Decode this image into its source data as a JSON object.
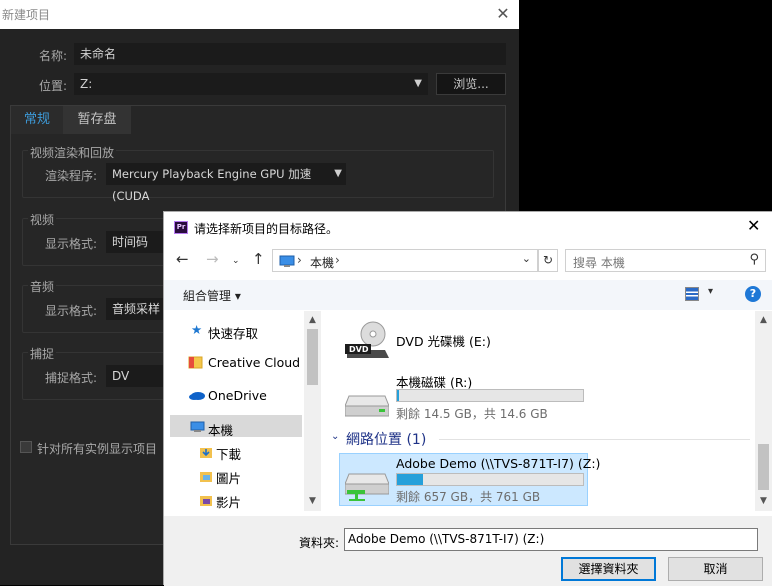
{
  "new_project": {
    "title": "新建项目",
    "close": "✕",
    "name_label": "名称:",
    "name_value": "未命名",
    "location_label": "位置:",
    "location_value": "Z:",
    "browse_label": "浏览...",
    "tabs": [
      {
        "label": "常规",
        "active": true
      },
      {
        "label": "暂存盘",
        "active": false
      }
    ],
    "sections": {
      "render": {
        "title": "视频渲染和回放",
        "renderer_label": "渲染程序:",
        "renderer_value": "Mercury Playback Engine GPU 加速 (CUDA"
      },
      "video": {
        "title": "视频",
        "format_label": "显示格式:",
        "format_value": "时间码"
      },
      "audio": {
        "title": "音频",
        "format_label": "显示格式:",
        "format_value": "音频采样"
      },
      "capture": {
        "title": "捕捉",
        "format_label": "捕捉格式:",
        "format_value": "DV"
      }
    },
    "checkbox_label": "针对所有实例显示项目",
    "accent_color": "#3d9ad8"
  },
  "folder_picker": {
    "title": "请选择新项目的目标路径。",
    "address": {
      "crumb": "本機",
      "separator": "›"
    },
    "search_placeholder": "搜尋 本機",
    "organize_label": "組合管理",
    "help_label": "?",
    "nav_items": [
      {
        "label": "快速存取",
        "icon": "star-icon"
      },
      {
        "label": "Creative Cloud Fi",
        "icon": "cc-folder-icon"
      },
      {
        "label": "OneDrive",
        "icon": "cloud-icon"
      },
      {
        "label": "本機",
        "icon": "computer-icon",
        "selected": true
      },
      {
        "label": "下載",
        "icon": "download-folder-icon"
      },
      {
        "label": "圖片",
        "icon": "pictures-folder-icon"
      },
      {
        "label": "影片",
        "icon": "videos-folder-icon"
      }
    ],
    "drives": [
      {
        "label": "DVD 光碟機 (E:)",
        "icon": "dvd-drive-icon"
      },
      {
        "label": "本機磁碟 (R:)",
        "sub": "剩餘 14.5 GB，共 14.6 GB",
        "fill_ratio": 0.007,
        "icon": "hard-drive-icon"
      }
    ],
    "network_group": "網路位置 (1)",
    "network_drive": {
      "label": "Adobe Demo (\\\\TVS-871T-I7) (Z:)",
      "sub": "剩餘 657 GB，共 761 GB",
      "fill_ratio": 0.14,
      "icon": "network-drive-icon"
    },
    "folder_label": "資料夾:",
    "folder_value": "Adobe Demo (\\\\TVS-871T-I7) (Z:)",
    "select_button": "選擇資料夾",
    "cancel_button": "取消",
    "colors": {
      "bar_fill": "#26a0da",
      "selection": "#cce8ff",
      "group_header": "#1e3287"
    }
  }
}
